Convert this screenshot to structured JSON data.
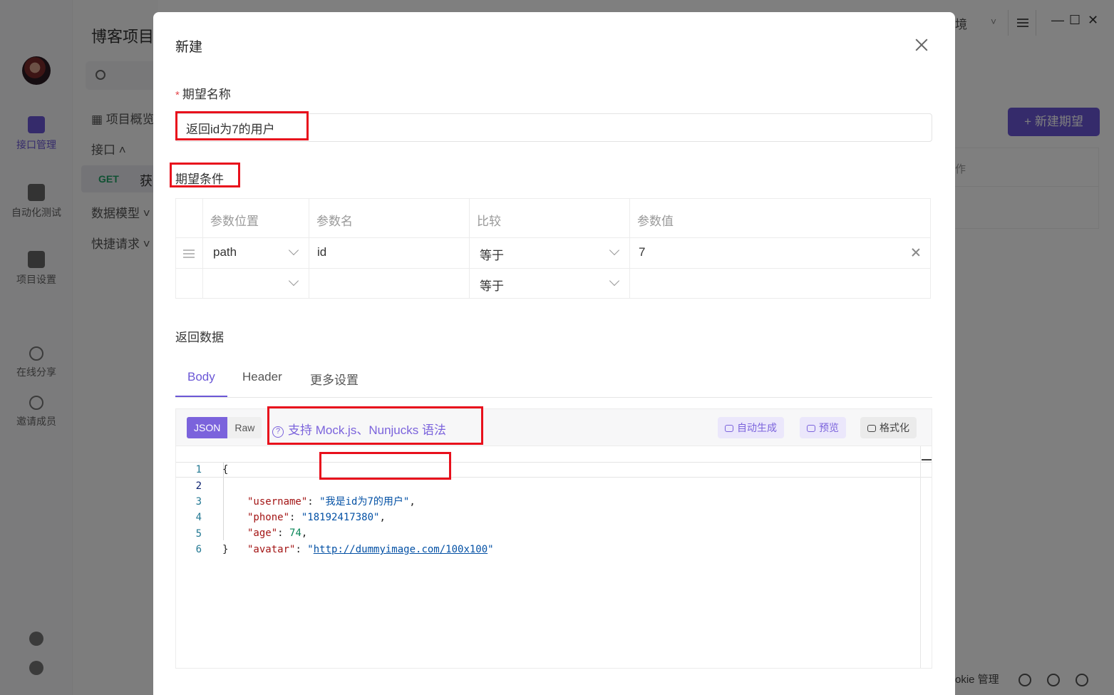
{
  "background": {
    "project_title": "博客项目",
    "rail": [
      {
        "label": "接口管理",
        "icon": "api-icon"
      },
      {
        "label": "自动化测试",
        "icon": "automation-icon"
      },
      {
        "label": "项目设置",
        "icon": "project-settings-icon"
      },
      {
        "label": "在线分享",
        "icon": "share-icon"
      },
      {
        "label": "邀请成员",
        "icon": "invite-member-icon"
      }
    ],
    "tree": {
      "overview": "项目概览",
      "interfaces": "接口",
      "method": "GET",
      "endpoint": "获",
      "models": "数据模型",
      "quick": "快捷请求"
    },
    "env_label": "境",
    "new_expectation_button": "+ 新建期望",
    "right_table_header": "作",
    "footer_cookie": "okie 管理"
  },
  "modal": {
    "title": "新建",
    "name_label": "期望名称",
    "name_required_mark": "*",
    "name_value": "返回id为7的用户",
    "conditions_label": "期望条件",
    "conditions": {
      "headers": [
        "参数位置",
        "参数名",
        "比较",
        "参数值"
      ],
      "rows": [
        {
          "position": "path",
          "name": "id",
          "compare": "等于",
          "value": "7"
        },
        {
          "position": "",
          "name": "",
          "compare": "等于",
          "value": ""
        }
      ]
    },
    "return_label": "返回数据",
    "tabs": [
      "Body",
      "Header",
      "更多设置"
    ],
    "active_tab": "Body",
    "body_modes": [
      "JSON",
      "Raw"
    ],
    "active_mode": "JSON",
    "syntax_hint": "支持 Mock.js、Nunjucks 语法",
    "toolbar_buttons": {
      "auto_generate": "自动生成",
      "preview": "预览",
      "format": "格式化"
    },
    "code": {
      "line_numbers": [
        "1",
        "2",
        "3",
        "4",
        "5",
        "6"
      ],
      "open_brace": "{",
      "close_brace": "}",
      "fields": [
        {
          "key": "\"username\"",
          "value": "\"我是id为7的用户\"",
          "suffix": ","
        },
        {
          "key": "\"phone\"",
          "value": "\"18192417380\"",
          "suffix": ","
        },
        {
          "key": "\"age\"",
          "value": "74",
          "suffix": ","
        },
        {
          "key": "\"avatar\"",
          "value_url": "http://dummyimage.com/100x100",
          "suffix": ""
        }
      ]
    }
  },
  "colors": {
    "accent": "#6b57d6",
    "annotation_red": "#e8101c",
    "get_method": "#21a366"
  }
}
